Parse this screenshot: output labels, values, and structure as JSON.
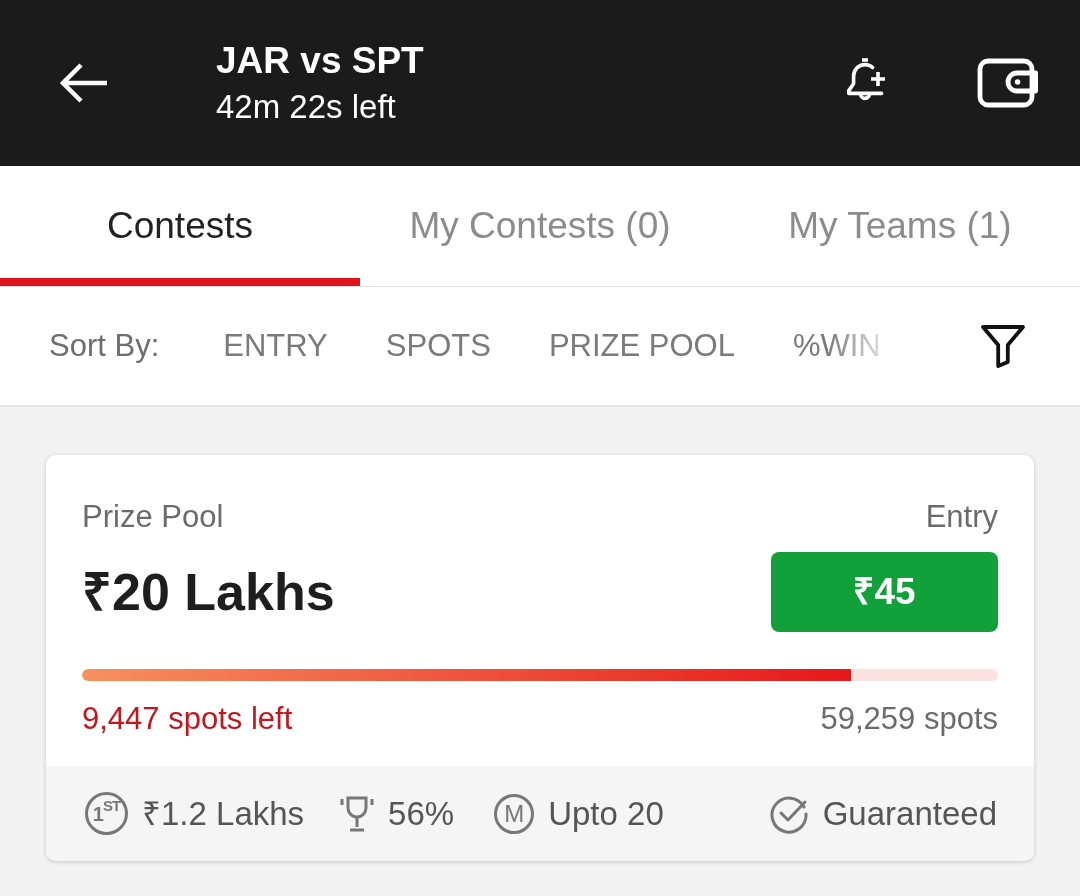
{
  "header": {
    "title": "JAR vs SPT",
    "subtitle": "42m 22s left"
  },
  "tabs": [
    {
      "label": "Contests",
      "selected": true
    },
    {
      "label": "My Contests (0)",
      "selected": false
    },
    {
      "label": "My Teams (1)",
      "selected": false
    }
  ],
  "sort_bar": {
    "label": "Sort By:",
    "options": [
      "ENTRY",
      "SPOTS",
      "PRIZE POOL",
      "%WIN"
    ]
  },
  "contests": [
    {
      "prize_label": "Prize Pool",
      "prize": "₹20 Lakhs",
      "entry_label": "Entry",
      "entry_fee": "₹45",
      "level": 0.84,
      "spots_left": "9,447 spots left",
      "total_spots": "59,259 spots",
      "features": [
        {
          "kind": "first_prize",
          "icon_text": "1$^{ST}$",
          "text": "₹1.2 Lakhs"
        },
        {
          "kind": "win_rate",
          "text": "56%"
        },
        {
          "kind": "max_entries",
          "icon_text": "M",
          "text": "Upto 20"
        },
        {
          "kind": "guaranteed",
          "text": "Guaranteed"
        }
      ]
    }
  ]
}
